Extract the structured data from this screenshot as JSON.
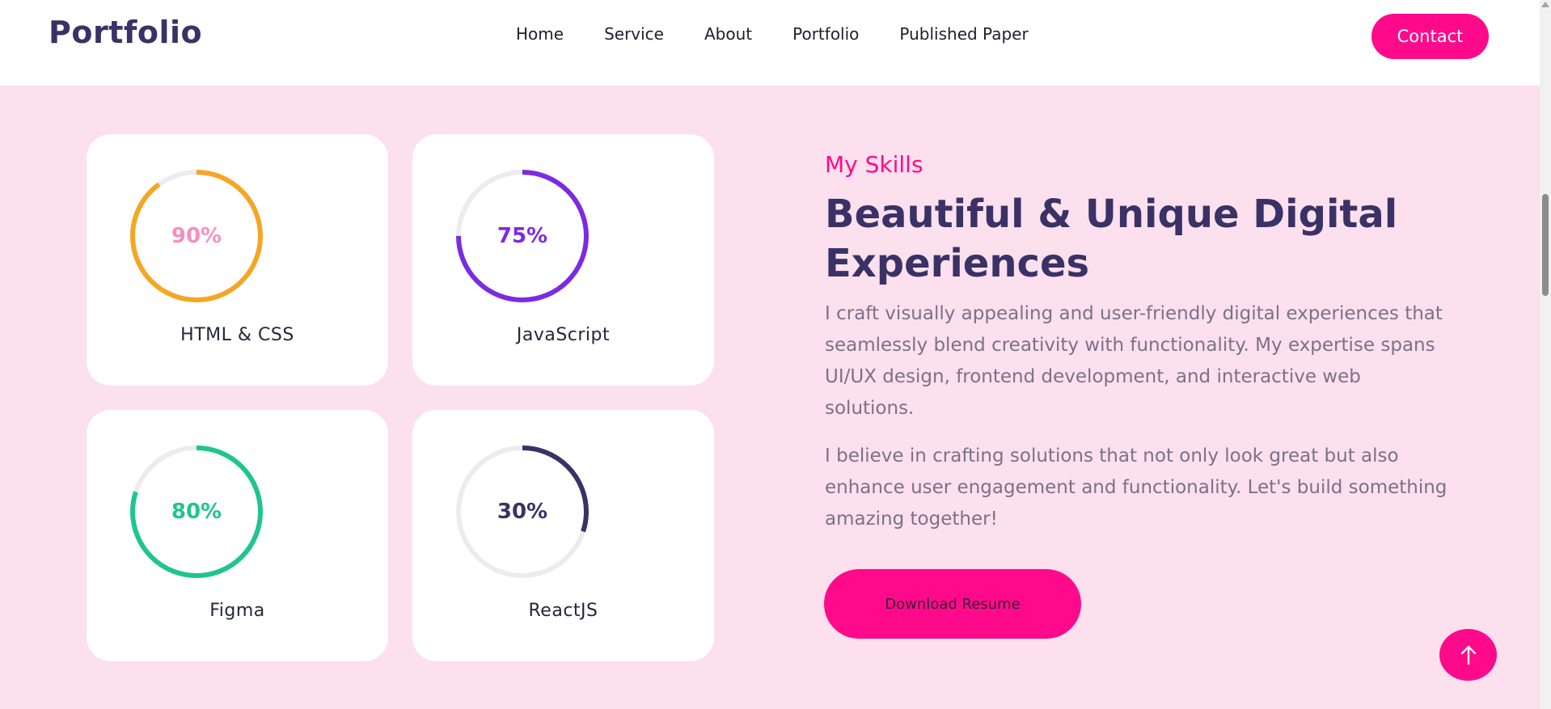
{
  "header": {
    "logo": "Portfolio",
    "nav": [
      "Home",
      "Service",
      "About",
      "Portfolio",
      "Published Paper"
    ],
    "contact_label": "Contact"
  },
  "skills": [
    {
      "name": "HTML & CSS",
      "percent_label": "90%",
      "percent": 0.9,
      "color": "#f6a623",
      "text_color": "#f78fbe"
    },
    {
      "name": "JavaScript",
      "percent_label": "75%",
      "percent": 0.75,
      "color": "#7b2be2",
      "text_color": "#7b2be2"
    },
    {
      "name": "Figma",
      "percent_label": "80%",
      "percent": 0.8,
      "color": "#1fc58e",
      "text_color": "#1fc58e"
    },
    {
      "name": "ReactJS",
      "percent_label": "30%",
      "percent": 0.3,
      "color": "#3a3266",
      "text_color": "#3a3266"
    }
  ],
  "about": {
    "subtitle": "My Skills",
    "title": "Beautiful & Unique Digital Experiences",
    "paragraph1": "I craft visually appealing and user-friendly digital experiences that seamlessly blend creativity with functionality. My expertise spans UI/UX design, frontend development, and interactive web solutions.",
    "paragraph2": "I believe in crafting solutions that not only look great but also enhance user engagement and functionality. Let's build something amazing together!",
    "download_label": "Download Resume"
  },
  "icons": {
    "back_to_top": "arrow-up-icon"
  },
  "colors": {
    "accent": "#ff0a8a",
    "brand": "#3a3266",
    "section_bg": "#fce0ee",
    "ring_track": "#ececee"
  }
}
